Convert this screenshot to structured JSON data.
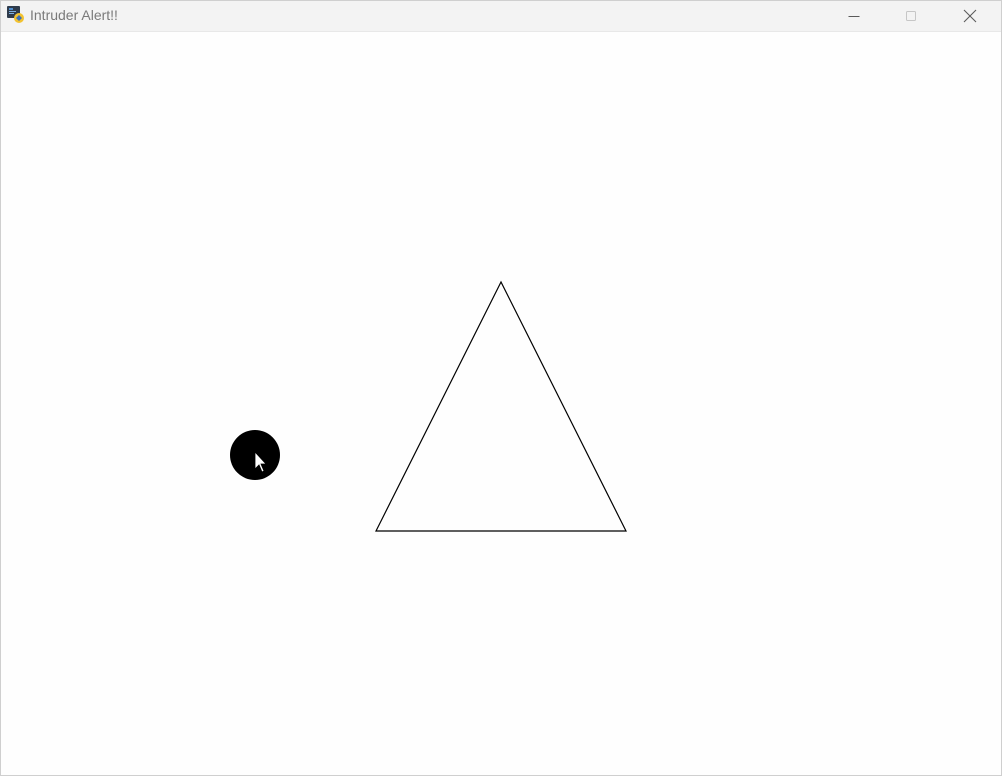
{
  "window": {
    "title": "Intruder Alert!!",
    "app_icon": "python-icon"
  },
  "titlebar_buttons": {
    "minimize_icon": "minimize-icon",
    "maximize_icon": "maximize-icon",
    "close_icon": "close-icon"
  },
  "canvas": {
    "background_color": "#fefefe",
    "shapes": {
      "triangle": {
        "stroke_color": "#000000",
        "fill": "none"
      },
      "player_circle": {
        "fill_color": "#000000"
      }
    },
    "cursor_icon": "arrow-cursor-icon"
  }
}
